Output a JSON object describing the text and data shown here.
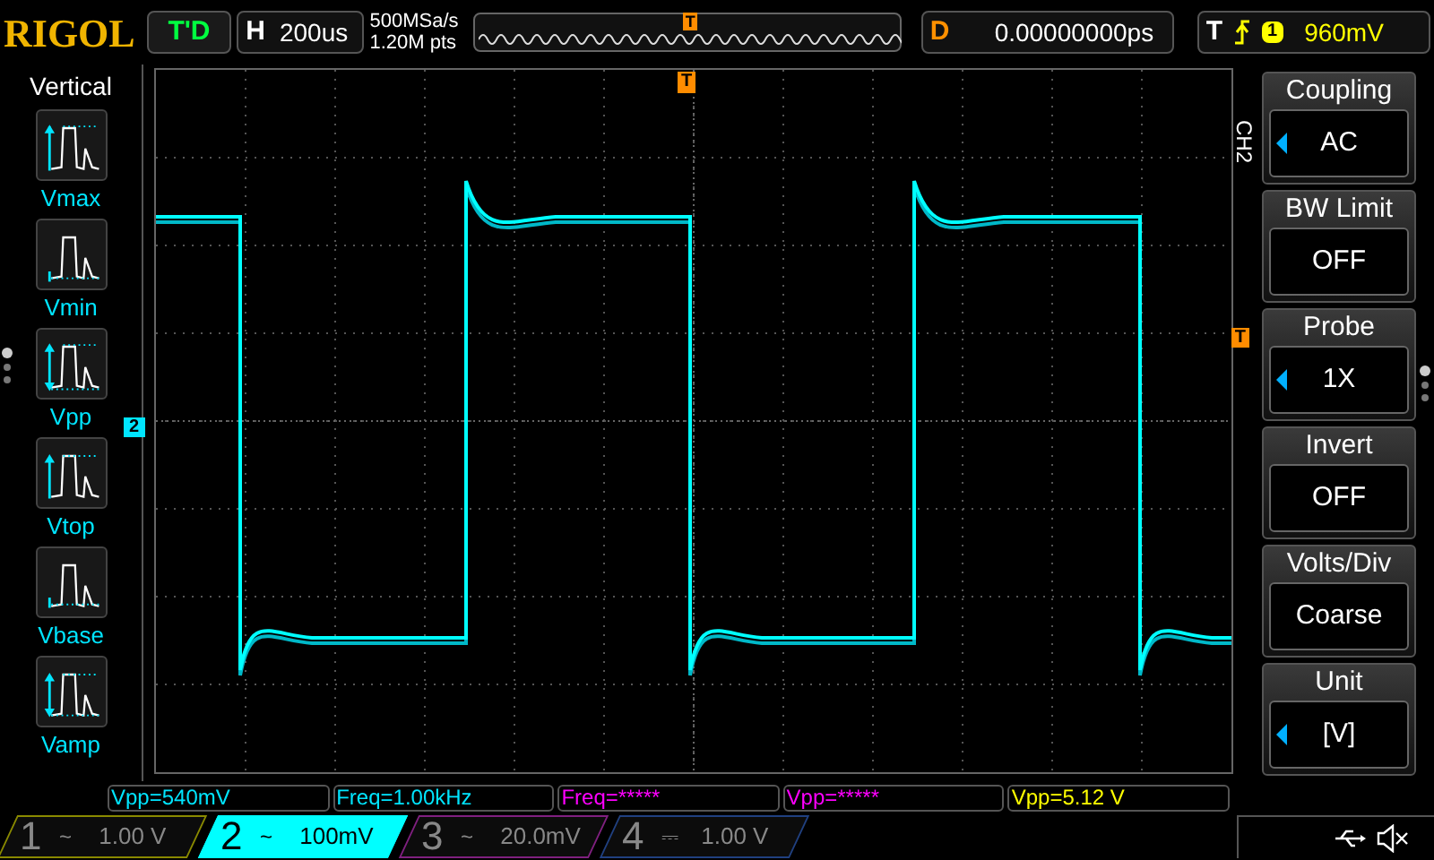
{
  "header": {
    "logo": "RIGOL",
    "run_status": "T'D",
    "horizontal": {
      "label": "H",
      "value": "200us"
    },
    "sample_rate": "500MSa/s",
    "memory_depth": "1.20M pts",
    "preview_marker": "T",
    "delay": {
      "label": "D",
      "value": "0.00000000ps"
    },
    "trigger": {
      "label": "T",
      "source": "1",
      "level": "960mV"
    }
  },
  "measure_menu": {
    "title": "Vertical",
    "items": [
      {
        "label": "Vmax",
        "kind": "vmax"
      },
      {
        "label": "Vmin",
        "kind": "vmin"
      },
      {
        "label": "Vpp",
        "kind": "vpp"
      },
      {
        "label": "Vtop",
        "kind": "vtop"
      },
      {
        "label": "Vbase",
        "kind": "vbase"
      },
      {
        "label": "Vamp",
        "kind": "vamp"
      }
    ]
  },
  "plot": {
    "channel_marker": "2",
    "trigger_position_marker": "T",
    "trigger_level_marker": "T"
  },
  "channel_menu": {
    "channel": "CH2",
    "items": [
      {
        "title": "Coupling",
        "value": "AC",
        "arrow": true
      },
      {
        "title": "BW Limit",
        "value": "OFF",
        "arrow": false
      },
      {
        "title": "Probe",
        "value": "1X",
        "arrow": true
      },
      {
        "title": "Invert",
        "value": "OFF",
        "arrow": false
      },
      {
        "title": "Volts/Div",
        "value": "Coarse",
        "arrow": false
      },
      {
        "title": "Unit",
        "value": "[V]",
        "arrow": true
      }
    ]
  },
  "measurements": [
    {
      "text": "Vpp=540mV",
      "color": "#00e5ff"
    },
    {
      "text": "Freq=1.00kHz",
      "color": "#00e5ff"
    },
    {
      "text": "Freq=*****",
      "color": "#ff00ff"
    },
    {
      "text": "Vpp=*****",
      "color": "#ff00ff"
    },
    {
      "text": "Vpp=5.12 V",
      "color": "#ffff00"
    }
  ],
  "channels": [
    {
      "number": "1",
      "coupling": "~",
      "scale": "1.00 V",
      "selected": false,
      "color": "#8a8a00"
    },
    {
      "number": "2",
      "coupling": "~",
      "scale": "100mV",
      "selected": true,
      "color": "#00ffff"
    },
    {
      "number": "3",
      "coupling": "~",
      "scale": "20.0mV",
      "selected": false,
      "color": "#802080"
    },
    {
      "number": "4",
      "coupling": "⎓",
      "scale": "1.00 V",
      "selected": false,
      "color": "#204080"
    }
  ]
}
